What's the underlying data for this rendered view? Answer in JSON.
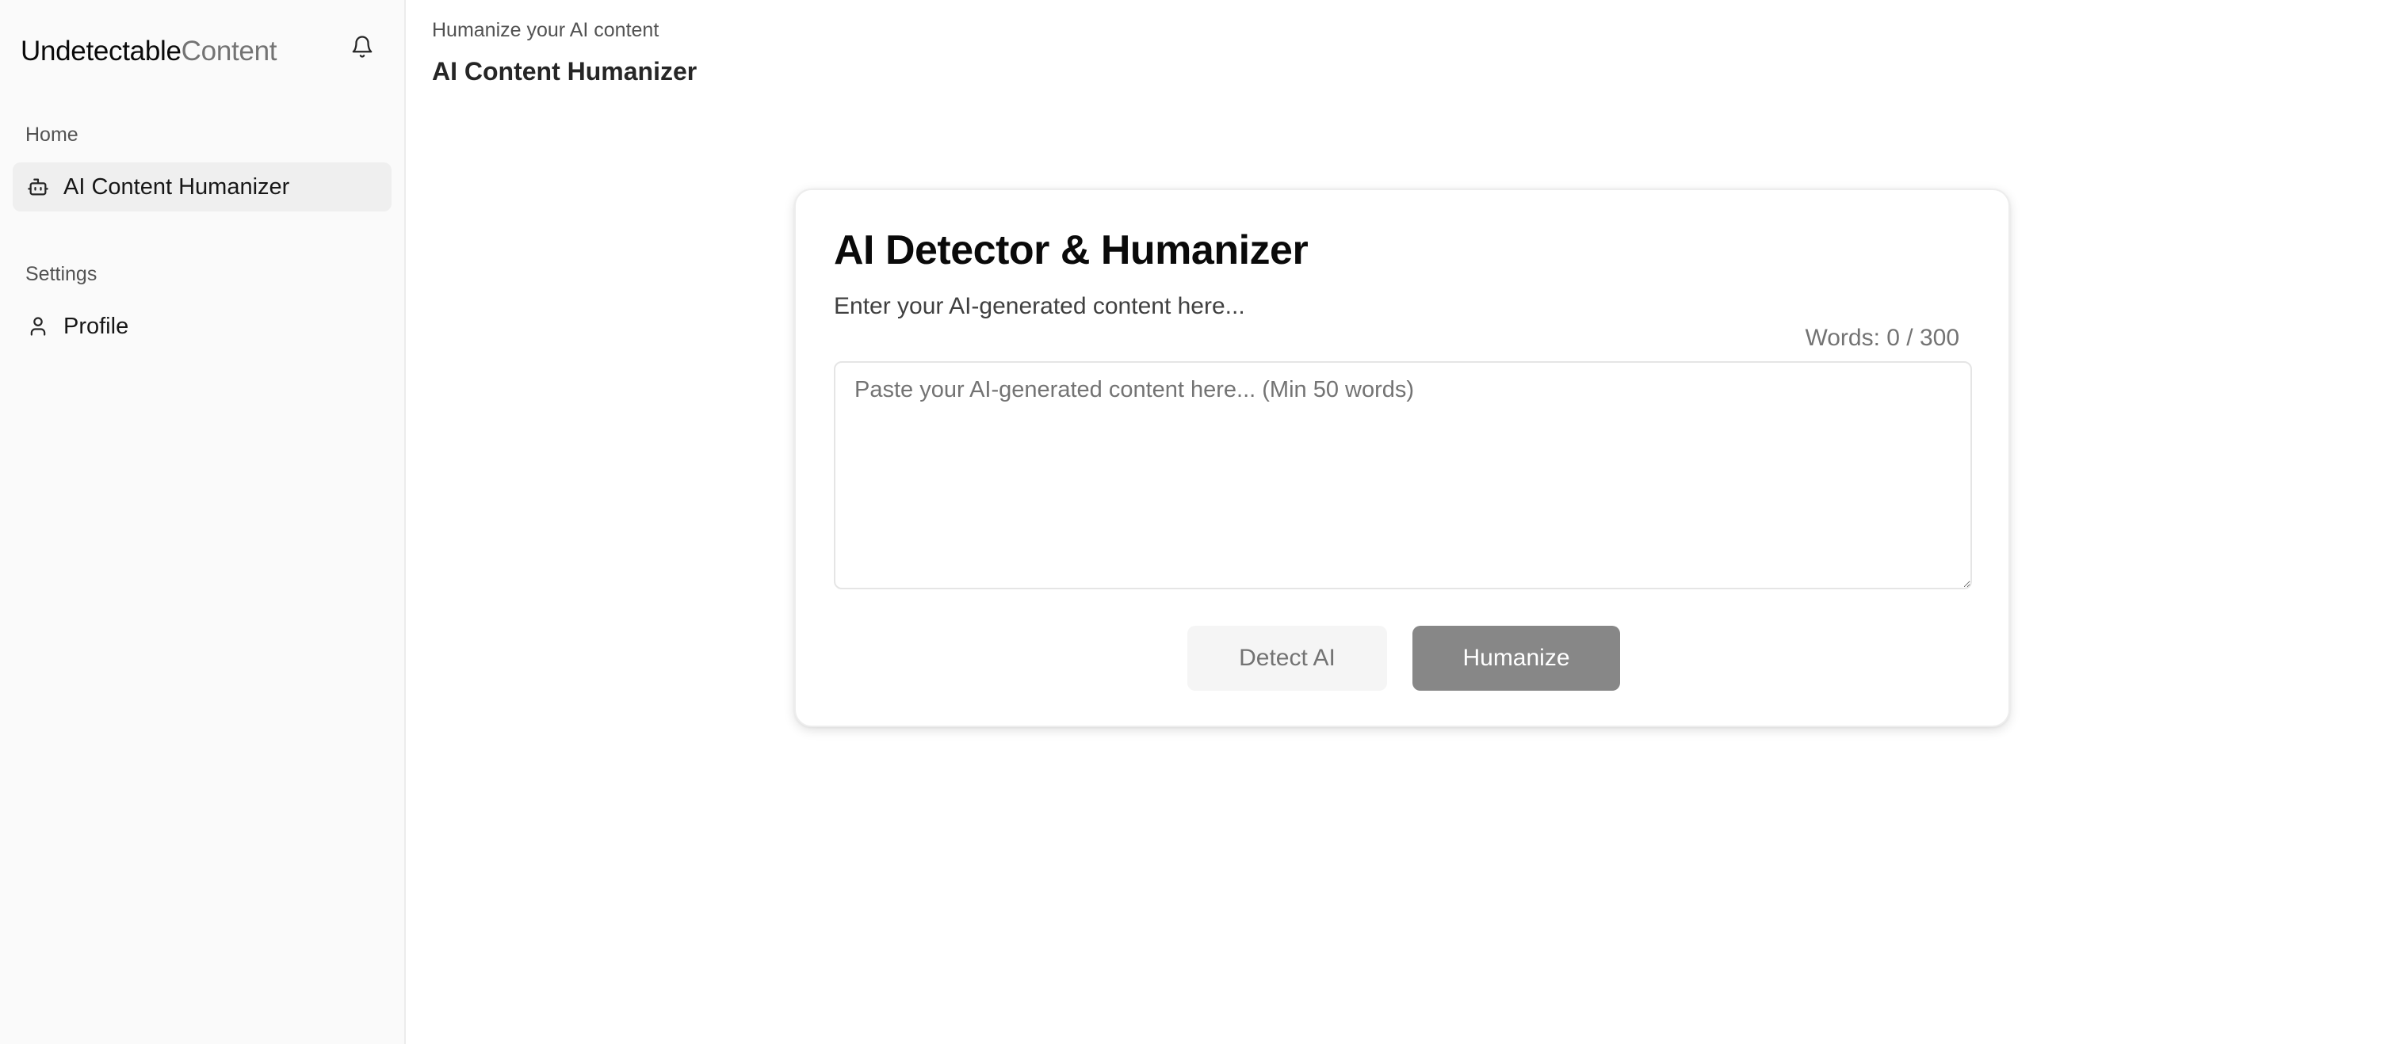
{
  "brand": {
    "strong": "Undetectable",
    "light": "Content"
  },
  "sidebar": {
    "groups": [
      {
        "label": "Home",
        "items": [
          {
            "label": "AI Content Humanizer",
            "icon": "bot-icon",
            "active": true
          }
        ]
      },
      {
        "label": "Settings",
        "items": [
          {
            "label": "Profile",
            "icon": "user-icon",
            "active": false
          }
        ]
      }
    ]
  },
  "header": {
    "breadcrumb": "Humanize your AI content",
    "title": "AI Content Humanizer"
  },
  "card": {
    "title": "AI Detector & Humanizer",
    "subtitle": "Enter your AI-generated content here...",
    "word_count": "Words: 0 / 300",
    "input": {
      "value": "",
      "placeholder": "Paste your AI-generated content here... (Min 50 words)"
    },
    "detect_label": "Detect AI",
    "humanize_label": "Humanize"
  },
  "colors": {
    "sidebar_bg": "#fafafa",
    "active_item_bg": "#efefef",
    "humanize_button": "#878787",
    "detect_button": "#f5f5f5"
  }
}
